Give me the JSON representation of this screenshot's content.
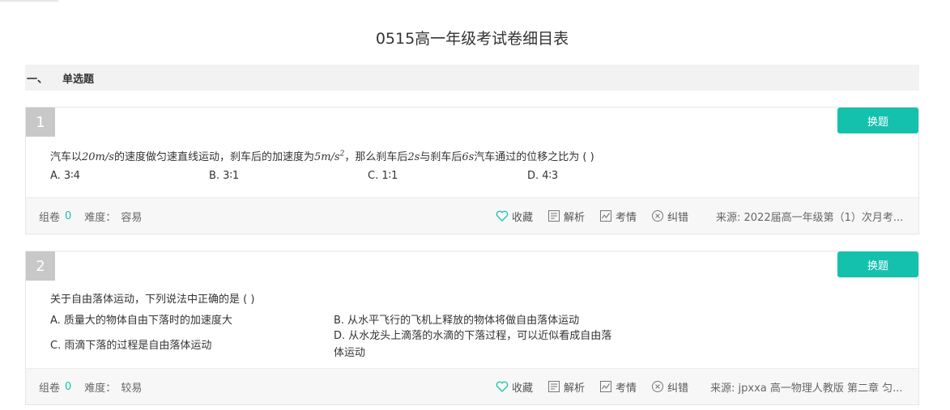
{
  "page": {
    "title": "0515高一年级考试卷细目表"
  },
  "section": {
    "number": "一、",
    "name": "单选题"
  },
  "questions": [
    {
      "num": "1",
      "swap_label": "换题",
      "stem_parts": {
        "a": "汽车以",
        "b": "20m/s",
        "c": "的速度做匀速直线运动，刹车后的加速度为",
        "d": "5m/s",
        "d_exp": "2",
        "e": "，那么刹车后",
        "f": "2s",
        "g": "与刹车后",
        "h": "6s",
        "i": "汽车通过的位移之比为 (    )"
      },
      "options": [
        "A. 3∶4",
        "B. 3∶1",
        "C. 1∶1",
        "D. 4∶3"
      ],
      "footer": {
        "group_label": "组卷",
        "group_count": "0",
        "difficulty_label": "难度：",
        "difficulty": "容易",
        "source": "来源: 2022届高一年级第（1）次月考..."
      }
    },
    {
      "num": "2",
      "swap_label": "换题",
      "stem": "关于自由落体运动，下列说法中正确的是 (    )",
      "options": [
        "A. 质量大的物体自由下落时的加速度大",
        "B. 从水平飞行的飞机上释放的物体将做自由落体运动",
        "C. 雨滴下落的过程是自由落体运动",
        "D. 从水龙头上滴落的水滴的下落过程，可以近似看成自由落体运动"
      ],
      "footer": {
        "group_label": "组卷",
        "group_count": "0",
        "difficulty_label": "难度：",
        "difficulty": "较易",
        "source": "来源: jpxxa 高一物理人教版 第二章 匀..."
      }
    }
  ],
  "actions": {
    "favorite": "收藏",
    "analysis": "解析",
    "exam_info": "考情",
    "correction": "纠错"
  },
  "colors": {
    "accent": "#14c1ad",
    "qnum_bg": "#c8c8c8"
  },
  "icons": {
    "favorite": "heart-icon",
    "analysis": "document-icon",
    "exam_info": "chart-icon",
    "correction": "x-circle-icon"
  }
}
